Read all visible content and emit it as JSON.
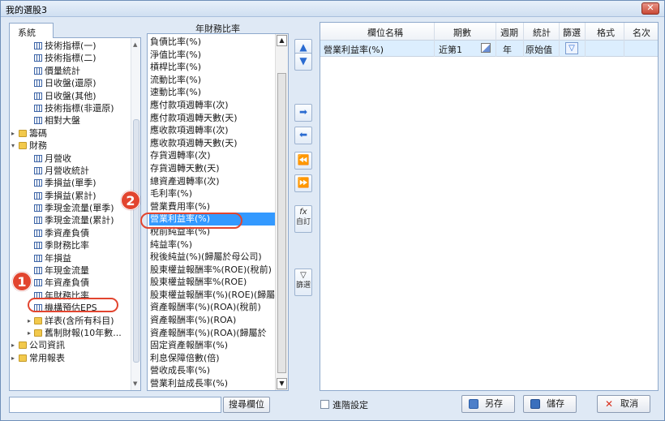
{
  "window": {
    "title": "我的選股3",
    "close_label": "✕"
  },
  "tree": {
    "tab_label": "系統",
    "items": [
      {
        "label": "技術指標(一)",
        "kind": "table",
        "indent": 2
      },
      {
        "label": "技術指標(二)",
        "kind": "table",
        "indent": 2
      },
      {
        "label": "價量統計",
        "kind": "table",
        "indent": 2
      },
      {
        "label": "日收盤(還原)",
        "kind": "table",
        "indent": 2
      },
      {
        "label": "日收盤(其他)",
        "kind": "table",
        "indent": 2
      },
      {
        "label": "技術指標(非還原)",
        "kind": "table",
        "indent": 2
      },
      {
        "label": "相對大盤",
        "kind": "table",
        "indent": 2
      },
      {
        "label": "籌碼",
        "kind": "folder",
        "indent": 1,
        "expander": "▸"
      },
      {
        "label": "財務",
        "kind": "folder",
        "indent": 1,
        "expander": "▾"
      },
      {
        "label": "月營收",
        "kind": "table",
        "indent": 2
      },
      {
        "label": "月營收統計",
        "kind": "table",
        "indent": 2
      },
      {
        "label": "季損益(單季)",
        "kind": "table",
        "indent": 2
      },
      {
        "label": "季損益(累計)",
        "kind": "table",
        "indent": 2
      },
      {
        "label": "季現金流量(單季)",
        "kind": "table",
        "indent": 2
      },
      {
        "label": "季現金流量(累計)",
        "kind": "table",
        "indent": 2
      },
      {
        "label": "季資產負債",
        "kind": "table",
        "indent": 2
      },
      {
        "label": "季財務比率",
        "kind": "table",
        "indent": 2
      },
      {
        "label": "年損益",
        "kind": "table",
        "indent": 2
      },
      {
        "label": "年現金流量",
        "kind": "table",
        "indent": 2
      },
      {
        "label": "年資產負債",
        "kind": "table",
        "indent": 2
      },
      {
        "label": "年財務比率",
        "kind": "table",
        "indent": 2
      },
      {
        "label": "機構預估EPS",
        "kind": "table",
        "indent": 2
      },
      {
        "label": "詳表(含所有科目)",
        "kind": "folder",
        "indent": 2,
        "expander": "▸"
      },
      {
        "label": "舊制財報(10年數...",
        "kind": "folder",
        "indent": 2,
        "expander": "▸"
      },
      {
        "label": "公司資訊",
        "kind": "folder",
        "indent": 1,
        "expander": "▸"
      },
      {
        "label": "常用報表",
        "kind": "folder",
        "indent": 1,
        "expander": "▸"
      }
    ]
  },
  "middle": {
    "header": "年財務比率",
    "items": [
      "負債比率(%)",
      "淨值比率(%)",
      "槓桿比率(%)",
      "流動比率(%)",
      "速動比率(%)",
      "應付款項週轉率(次)",
      "應付款項週轉天數(天)",
      "應收款項週轉率(次)",
      "應收款項週轉天數(天)",
      "存貨週轉率(次)",
      "存貨週轉天數(天)",
      "總資產週轉率(次)",
      "毛利率(%)",
      "營業費用率(%)",
      "營業利益率(%)",
      "稅前純益率(%)",
      "純益率(%)",
      "稅後純益(%)(歸屬於母公司)",
      "股東權益報酬率%(ROE)(稅前)",
      "股東權益報酬率%(ROE)",
      "股東權益報酬率(%)(ROE)(歸屬",
      "資產報酬率(%)(ROA)(稅前)",
      "資產報酬率(%)(ROA)",
      "資產報酬率(%)(ROA)(歸屬於",
      "固定資產報酬率(%)",
      "利息保障倍數(倍)",
      "營收成長率(%)",
      "營業利益成長率(%)"
    ],
    "selected_index": 14
  },
  "tools": {
    "up": "▲",
    "down": "▼",
    "add": "➡",
    "remove": "⬅",
    "remove_all": "⏪",
    "add_all": "⏩",
    "custom_icon": "fx",
    "custom_label": "自訂",
    "filter_icon": "▽",
    "filter_label": "篩選"
  },
  "grid": {
    "headers": [
      "欄位名稱",
      "期數",
      "週期",
      "統計",
      "篩選",
      "格式",
      "名次"
    ],
    "rows": [
      {
        "name": "營業利益率(%)",
        "period_count": "近第1",
        "cycle": "年",
        "stat": "原始值",
        "filter": "▽"
      }
    ]
  },
  "bottom": {
    "search_value": "",
    "search_button": "搜尋欄位",
    "advanced_label": "進階設定",
    "saveas_label": "另存",
    "save_label": "儲存",
    "cancel_label": "取消",
    "cancel_icon": "✕"
  },
  "annotations": {
    "one": "1",
    "two": "2"
  }
}
